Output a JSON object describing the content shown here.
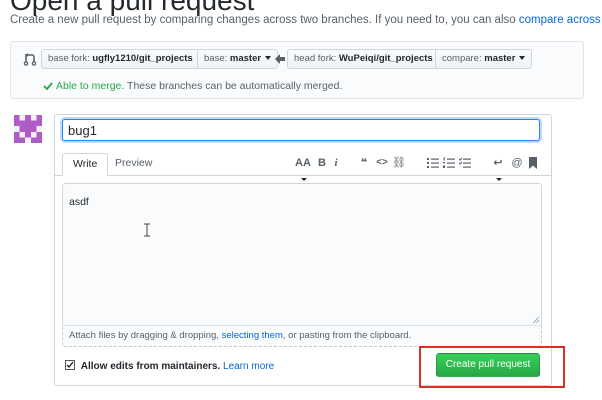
{
  "header": {
    "title": "Open a pull request",
    "subtitle_text": "Create a new pull request by comparing changes across two branches. If you need to, you can also ",
    "subtitle_link": "compare across forks",
    "subtitle_end": "."
  },
  "compare": {
    "base_fork_label": "base fork: ",
    "base_fork_value": "ugfly1210/git_projects",
    "base_label": "base: ",
    "base_value": "master",
    "head_fork_label": "head fork: ",
    "head_fork_value": "WuPeiqi/git_projects",
    "compare_label": "compare: ",
    "compare_value": "master",
    "merge_status": "Able to merge.",
    "merge_detail": " These branches can be automatically merged."
  },
  "form": {
    "title_value": "bug1",
    "tabs": [
      "Write",
      "Preview"
    ],
    "toolbar": {
      "heading": "AA",
      "bold": "B",
      "italic": "i",
      "quote": "❝",
      "code": "<>",
      "link": "⛓",
      "reply": "↩",
      "mention": "@"
    },
    "body_value": "asdf",
    "attach_pre": "Attach files by dragging & dropping, ",
    "attach_link": "selecting them",
    "attach_post": ", or pasting from the clipboard.",
    "maintainers_label": "Allow edits from maintainers.",
    "learn_more": "Learn more",
    "submit_label": "Create pull request"
  },
  "colors": {
    "accent_link": "#0366d6",
    "merge_ok": "#28a745",
    "submit_green": "#2ea44f",
    "highlight_red": "#d93025",
    "avatar_purple": "#b05cc6"
  },
  "icons": {
    "range": "git-compare-icon",
    "arrow": "arrow-left-icon",
    "check": "check-icon",
    "avatar": "identicon-avatar"
  }
}
